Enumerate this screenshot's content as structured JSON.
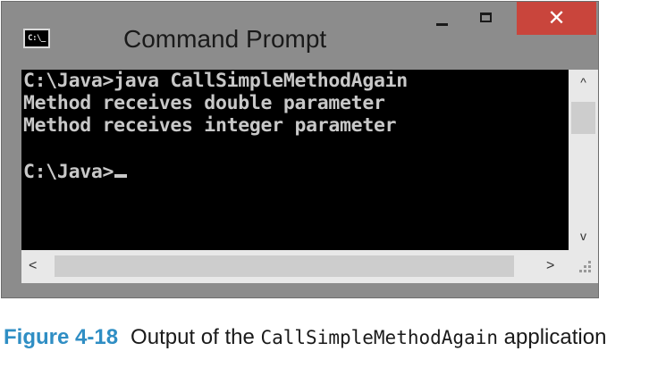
{
  "window": {
    "title": "Command Prompt",
    "icon_label": "C:\\_",
    "controls": {
      "minimize_icon": "minimize-icon",
      "maximize_icon": "maximize-icon",
      "close_glyph": "✕"
    }
  },
  "console": {
    "lines": [
      "C:\\Java>java CallSimpleMethodAgain",
      "Method receives double parameter",
      "Method receives integer parameter",
      "",
      "C:\\Java>"
    ],
    "text_color": "#c8c8c8",
    "background": "#000000"
  },
  "scrollbars": {
    "up_arrow": "^",
    "down_arrow": "v",
    "left_arrow": "<",
    "right_arrow": ">"
  },
  "caption": {
    "figure_label": "Figure 4-18",
    "text_before": "Output of the ",
    "code": "CallSimpleMethodAgain",
    "text_after": " application",
    "accent_color": "#2f8ec4"
  }
}
